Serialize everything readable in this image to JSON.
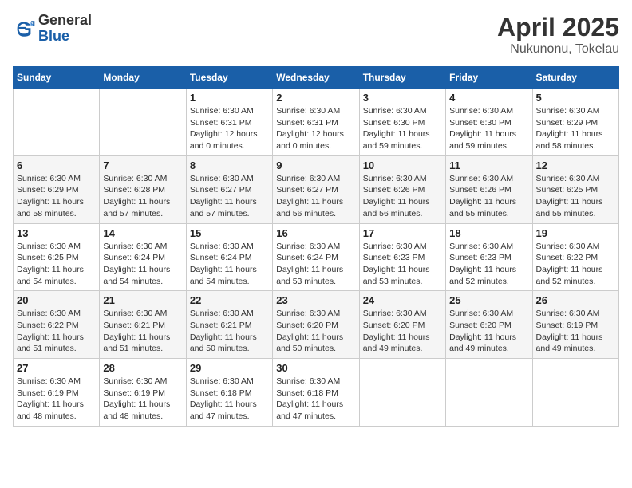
{
  "logo": {
    "general": "General",
    "blue": "Blue"
  },
  "title": "April 2025",
  "location": "Nukunonu, Tokelau",
  "weekdays": [
    "Sunday",
    "Monday",
    "Tuesday",
    "Wednesday",
    "Thursday",
    "Friday",
    "Saturday"
  ],
  "weeks": [
    [
      {
        "day": "",
        "info": ""
      },
      {
        "day": "",
        "info": ""
      },
      {
        "day": "1",
        "info": "Sunrise: 6:30 AM\nSunset: 6:31 PM\nDaylight: 12 hours\nand 0 minutes."
      },
      {
        "day": "2",
        "info": "Sunrise: 6:30 AM\nSunset: 6:31 PM\nDaylight: 12 hours\nand 0 minutes."
      },
      {
        "day": "3",
        "info": "Sunrise: 6:30 AM\nSunset: 6:30 PM\nDaylight: 11 hours\nand 59 minutes."
      },
      {
        "day": "4",
        "info": "Sunrise: 6:30 AM\nSunset: 6:30 PM\nDaylight: 11 hours\nand 59 minutes."
      },
      {
        "day": "5",
        "info": "Sunrise: 6:30 AM\nSunset: 6:29 PM\nDaylight: 11 hours\nand 58 minutes."
      }
    ],
    [
      {
        "day": "6",
        "info": "Sunrise: 6:30 AM\nSunset: 6:29 PM\nDaylight: 11 hours\nand 58 minutes."
      },
      {
        "day": "7",
        "info": "Sunrise: 6:30 AM\nSunset: 6:28 PM\nDaylight: 11 hours\nand 57 minutes."
      },
      {
        "day": "8",
        "info": "Sunrise: 6:30 AM\nSunset: 6:27 PM\nDaylight: 11 hours\nand 57 minutes."
      },
      {
        "day": "9",
        "info": "Sunrise: 6:30 AM\nSunset: 6:27 PM\nDaylight: 11 hours\nand 56 minutes."
      },
      {
        "day": "10",
        "info": "Sunrise: 6:30 AM\nSunset: 6:26 PM\nDaylight: 11 hours\nand 56 minutes."
      },
      {
        "day": "11",
        "info": "Sunrise: 6:30 AM\nSunset: 6:26 PM\nDaylight: 11 hours\nand 55 minutes."
      },
      {
        "day": "12",
        "info": "Sunrise: 6:30 AM\nSunset: 6:25 PM\nDaylight: 11 hours\nand 55 minutes."
      }
    ],
    [
      {
        "day": "13",
        "info": "Sunrise: 6:30 AM\nSunset: 6:25 PM\nDaylight: 11 hours\nand 54 minutes."
      },
      {
        "day": "14",
        "info": "Sunrise: 6:30 AM\nSunset: 6:24 PM\nDaylight: 11 hours\nand 54 minutes."
      },
      {
        "day": "15",
        "info": "Sunrise: 6:30 AM\nSunset: 6:24 PM\nDaylight: 11 hours\nand 54 minutes."
      },
      {
        "day": "16",
        "info": "Sunrise: 6:30 AM\nSunset: 6:24 PM\nDaylight: 11 hours\nand 53 minutes."
      },
      {
        "day": "17",
        "info": "Sunrise: 6:30 AM\nSunset: 6:23 PM\nDaylight: 11 hours\nand 53 minutes."
      },
      {
        "day": "18",
        "info": "Sunrise: 6:30 AM\nSunset: 6:23 PM\nDaylight: 11 hours\nand 52 minutes."
      },
      {
        "day": "19",
        "info": "Sunrise: 6:30 AM\nSunset: 6:22 PM\nDaylight: 11 hours\nand 52 minutes."
      }
    ],
    [
      {
        "day": "20",
        "info": "Sunrise: 6:30 AM\nSunset: 6:22 PM\nDaylight: 11 hours\nand 51 minutes."
      },
      {
        "day": "21",
        "info": "Sunrise: 6:30 AM\nSunset: 6:21 PM\nDaylight: 11 hours\nand 51 minutes."
      },
      {
        "day": "22",
        "info": "Sunrise: 6:30 AM\nSunset: 6:21 PM\nDaylight: 11 hours\nand 50 minutes."
      },
      {
        "day": "23",
        "info": "Sunrise: 6:30 AM\nSunset: 6:20 PM\nDaylight: 11 hours\nand 50 minutes."
      },
      {
        "day": "24",
        "info": "Sunrise: 6:30 AM\nSunset: 6:20 PM\nDaylight: 11 hours\nand 49 minutes."
      },
      {
        "day": "25",
        "info": "Sunrise: 6:30 AM\nSunset: 6:20 PM\nDaylight: 11 hours\nand 49 minutes."
      },
      {
        "day": "26",
        "info": "Sunrise: 6:30 AM\nSunset: 6:19 PM\nDaylight: 11 hours\nand 49 minutes."
      }
    ],
    [
      {
        "day": "27",
        "info": "Sunrise: 6:30 AM\nSunset: 6:19 PM\nDaylight: 11 hours\nand 48 minutes."
      },
      {
        "day": "28",
        "info": "Sunrise: 6:30 AM\nSunset: 6:19 PM\nDaylight: 11 hours\nand 48 minutes."
      },
      {
        "day": "29",
        "info": "Sunrise: 6:30 AM\nSunset: 6:18 PM\nDaylight: 11 hours\nand 47 minutes."
      },
      {
        "day": "30",
        "info": "Sunrise: 6:30 AM\nSunset: 6:18 PM\nDaylight: 11 hours\nand 47 minutes."
      },
      {
        "day": "",
        "info": ""
      },
      {
        "day": "",
        "info": ""
      },
      {
        "day": "",
        "info": ""
      }
    ]
  ]
}
